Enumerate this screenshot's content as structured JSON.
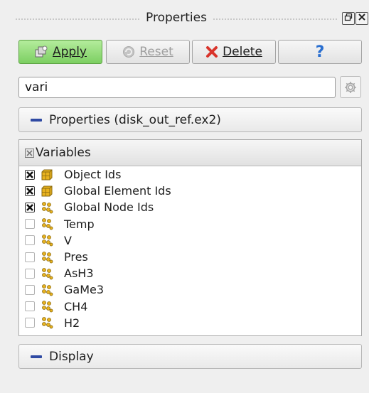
{
  "title": "Properties",
  "buttons": {
    "apply_label": "Apply",
    "reset_label": "Reset",
    "delete_label": "Delete",
    "help_label": "?"
  },
  "search": {
    "value": "vari"
  },
  "sections": {
    "properties_label": "Properties (disk_out_ref.ex2)",
    "display_label": "Display"
  },
  "variables": {
    "header": "Variables",
    "items": [
      {
        "label": "Object Ids",
        "checked": true,
        "icon": "cell-data-icon"
      },
      {
        "label": "Global Element Ids",
        "checked": true,
        "icon": "cell-data-icon"
      },
      {
        "label": "Global Node Ids",
        "checked": true,
        "icon": "point-data-icon"
      },
      {
        "label": "Temp",
        "checked": false,
        "icon": "point-data-icon"
      },
      {
        "label": "V",
        "checked": false,
        "icon": "point-data-icon"
      },
      {
        "label": "Pres",
        "checked": false,
        "icon": "point-data-icon"
      },
      {
        "label": "AsH3",
        "checked": false,
        "icon": "point-data-icon"
      },
      {
        "label": "GaMe3",
        "checked": false,
        "icon": "point-data-icon"
      },
      {
        "label": "CH4",
        "checked": false,
        "icon": "point-data-icon"
      },
      {
        "label": "H2",
        "checked": false,
        "icon": "point-data-icon"
      }
    ]
  },
  "colors": {
    "apply_green": "#7ccf62",
    "delete_red": "#d9342b",
    "help_blue": "#2a6fd0",
    "section_minus": "#2f4aa3",
    "data_icon_yellow": "#e8b21e"
  }
}
